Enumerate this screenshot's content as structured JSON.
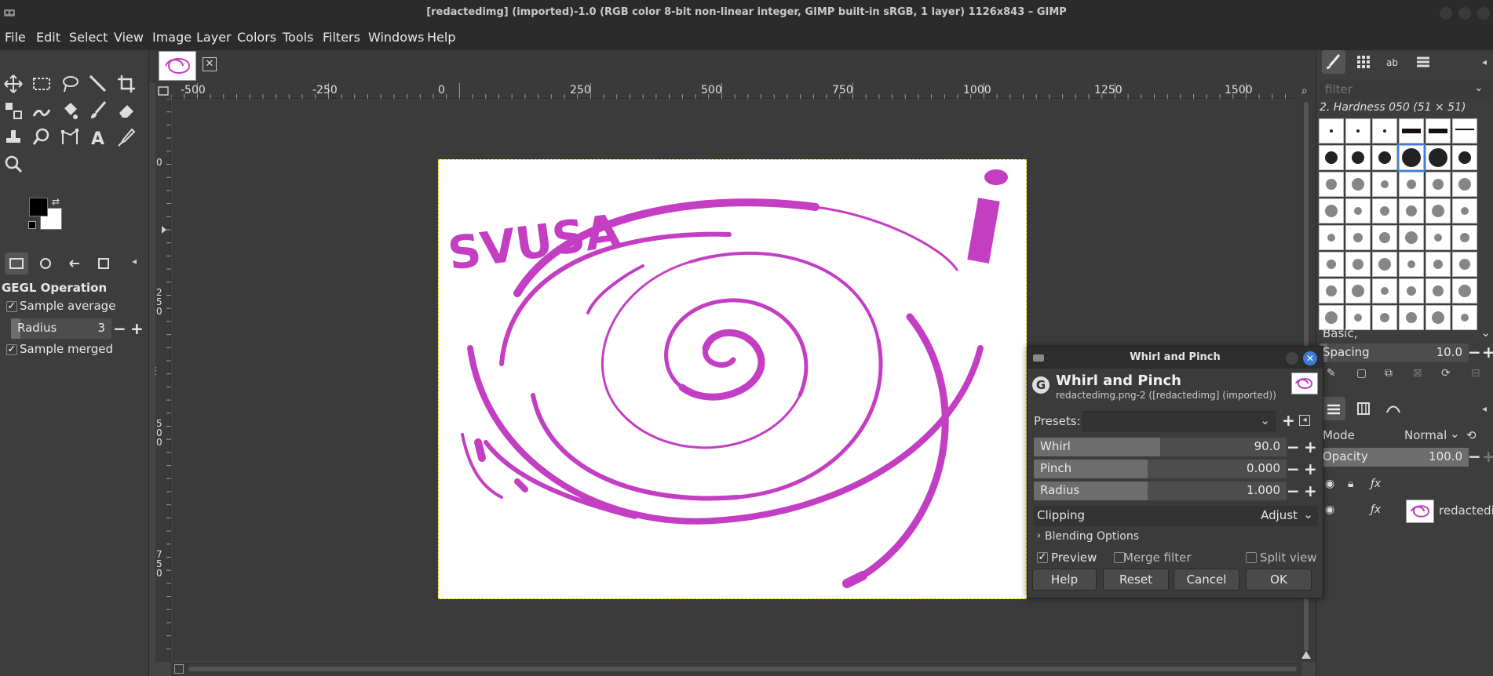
{
  "window": {
    "title": "[redactedimg] (imported)-1.0 (RGB color 8-bit non-linear integer, GIMP built-in sRGB, 1 layer) 1126x843 – GIMP"
  },
  "menu": [
    "File",
    "Edit",
    "Select",
    "View",
    "Image",
    "Layer",
    "Colors",
    "Tools",
    "Filters",
    "Windows",
    "Help"
  ],
  "tool_options": {
    "heading": "GEGL Operation",
    "sample_average": "Sample average",
    "radius_label": "Radius",
    "radius_value": "3",
    "sample_merged": "Sample merged"
  },
  "rulers": {
    "horizontal": [
      "-500",
      "-250",
      "0",
      "250",
      "500",
      "750",
      "1000",
      "1250",
      "1500"
    ],
    "vertical": [
      "0",
      "250",
      "500",
      "750"
    ]
  },
  "right_dock": {
    "filter_placeholder": "filter",
    "brush_name": "2. Hardness 050 (51 × 51)",
    "brush_set": "Basic,",
    "spacing_label": "Spacing",
    "spacing_value": "10.0",
    "mode_label": "Mode",
    "mode_value": "Normal",
    "opacity_label": "Opacity",
    "opacity_value": "100.0",
    "layer_name": "redactedim"
  },
  "dialog": {
    "window_title": "Whirl and Pinch",
    "heading": "Whirl and Pinch",
    "subtitle": "redactedimg.png-2 ([redactedimg] (imported))",
    "presets_label": "Presets:",
    "params": [
      {
        "label": "Whirl",
        "value": "90.0",
        "fill_fraction": 0.5
      },
      {
        "label": "Pinch",
        "value": "0.000",
        "fill_fraction": 0.45
      },
      {
        "label": "Radius",
        "value": "1.000",
        "fill_fraction": 0.45
      }
    ],
    "clipping_label": "Clipping",
    "clipping_value": "Adjust",
    "blending_options": "Blending Options",
    "preview_label": "Preview",
    "merge_filter_label": "Merge filter",
    "split_view_label": "Split view",
    "buttons": {
      "help": "Help",
      "reset": "Reset",
      "cancel": "Cancel",
      "ok": "OK"
    }
  },
  "colors": {
    "accent_blue": "#3c7dd9",
    "swirl_magenta": "#c43ec4"
  }
}
